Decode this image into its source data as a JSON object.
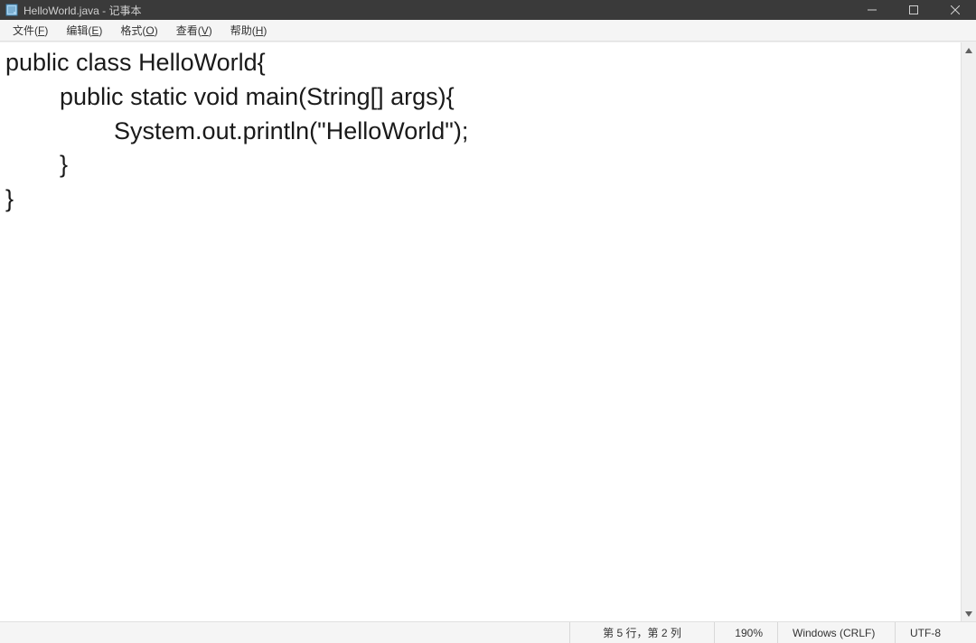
{
  "titlebar": {
    "title": "HelloWorld.java - 记事本"
  },
  "menubar": {
    "items": [
      {
        "label": "文件(",
        "accel": "F",
        "label_end": ")"
      },
      {
        "label": "编辑(",
        "accel": "E",
        "label_end": ")"
      },
      {
        "label": "格式(",
        "accel": "O",
        "label_end": ")"
      },
      {
        "label": "查看(",
        "accel": "V",
        "label_end": ")"
      },
      {
        "label": "帮助(",
        "accel": "H",
        "label_end": ")"
      }
    ]
  },
  "editor": {
    "content": "public class HelloWorld{\n\tpublic static void main(String[] args){\n\t\tSystem.out.println(\"HelloWorld\");\n\t}\n}"
  },
  "statusbar": {
    "position": "第 5 行，第 2 列",
    "zoom": "190%",
    "line_ending": "Windows (CRLF)",
    "encoding": "UTF-8"
  }
}
